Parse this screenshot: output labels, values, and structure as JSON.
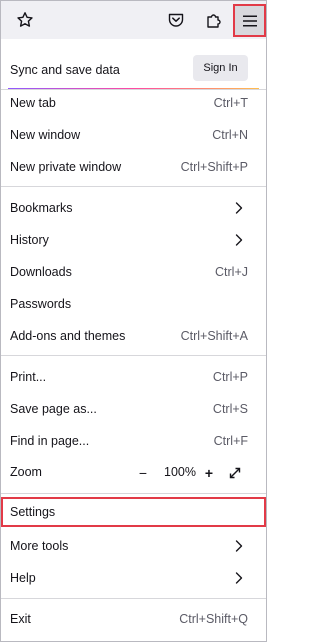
{
  "toolbar": {
    "icons": [
      "star-icon",
      "pocket-icon",
      "extensions-icon",
      "hamburger-menu-icon"
    ]
  },
  "menu": {
    "sync": {
      "label": "Sync and save data",
      "signin_label": "Sign In"
    },
    "items": [
      {
        "label": "New tab",
        "shortcut": "Ctrl+T"
      },
      {
        "label": "New window",
        "shortcut": "Ctrl+N"
      },
      {
        "label": "New private window",
        "shortcut": "Ctrl+Shift+P"
      },
      {
        "label": "Bookmarks",
        "submenu": true
      },
      {
        "label": "History",
        "submenu": true
      },
      {
        "label": "Downloads",
        "shortcut": "Ctrl+J"
      },
      {
        "label": "Passwords"
      },
      {
        "label": "Add-ons and themes",
        "shortcut": "Ctrl+Shift+A"
      },
      {
        "label": "Print...",
        "shortcut": "Ctrl+P"
      },
      {
        "label": "Save page as...",
        "shortcut": "Ctrl+S"
      },
      {
        "label": "Find in page...",
        "shortcut": "Ctrl+F"
      },
      {
        "label": "Settings"
      },
      {
        "label": "More tools",
        "submenu": true
      },
      {
        "label": "Help",
        "submenu": true
      },
      {
        "label": "Exit",
        "shortcut": "Ctrl+Shift+Q"
      }
    ],
    "zoom": {
      "label": "Zoom",
      "minus": "−",
      "value": "100%",
      "plus": "+"
    }
  },
  "colors": {
    "highlight": "#e23a47",
    "toolbar_bg": "#f0f0f4",
    "sync_gradient": [
      "#9059ff",
      "#ff4aa2",
      "#ffbd4f"
    ]
  }
}
